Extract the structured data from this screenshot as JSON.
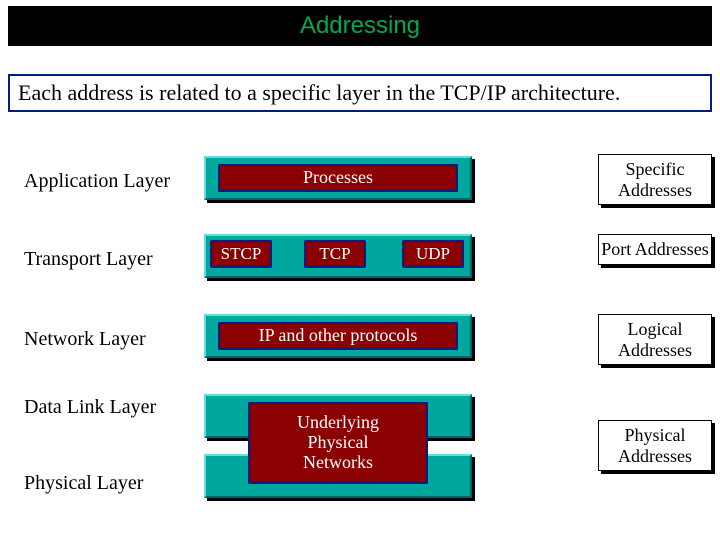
{
  "title": "Addressing",
  "subtitle": "Each address is related to a specific layer in the TCP/IP architecture.",
  "layers": {
    "application": "Application Layer",
    "transport": "Transport Layer",
    "network": "Network Layer",
    "datalink": "Data Link Layer",
    "physical": "Physical Layer"
  },
  "boxes": {
    "processes": "Processes",
    "stcp": "STCP",
    "tcp": "TCP",
    "udp": "UDP",
    "ip": "IP and other protocols",
    "underlying": "Underlying\nPhysical\nNetworks"
  },
  "addresses": {
    "specific": "Specific Addresses",
    "port": "Port Addresses",
    "logical": "Logical Addresses",
    "physical": "Physical Addresses"
  }
}
